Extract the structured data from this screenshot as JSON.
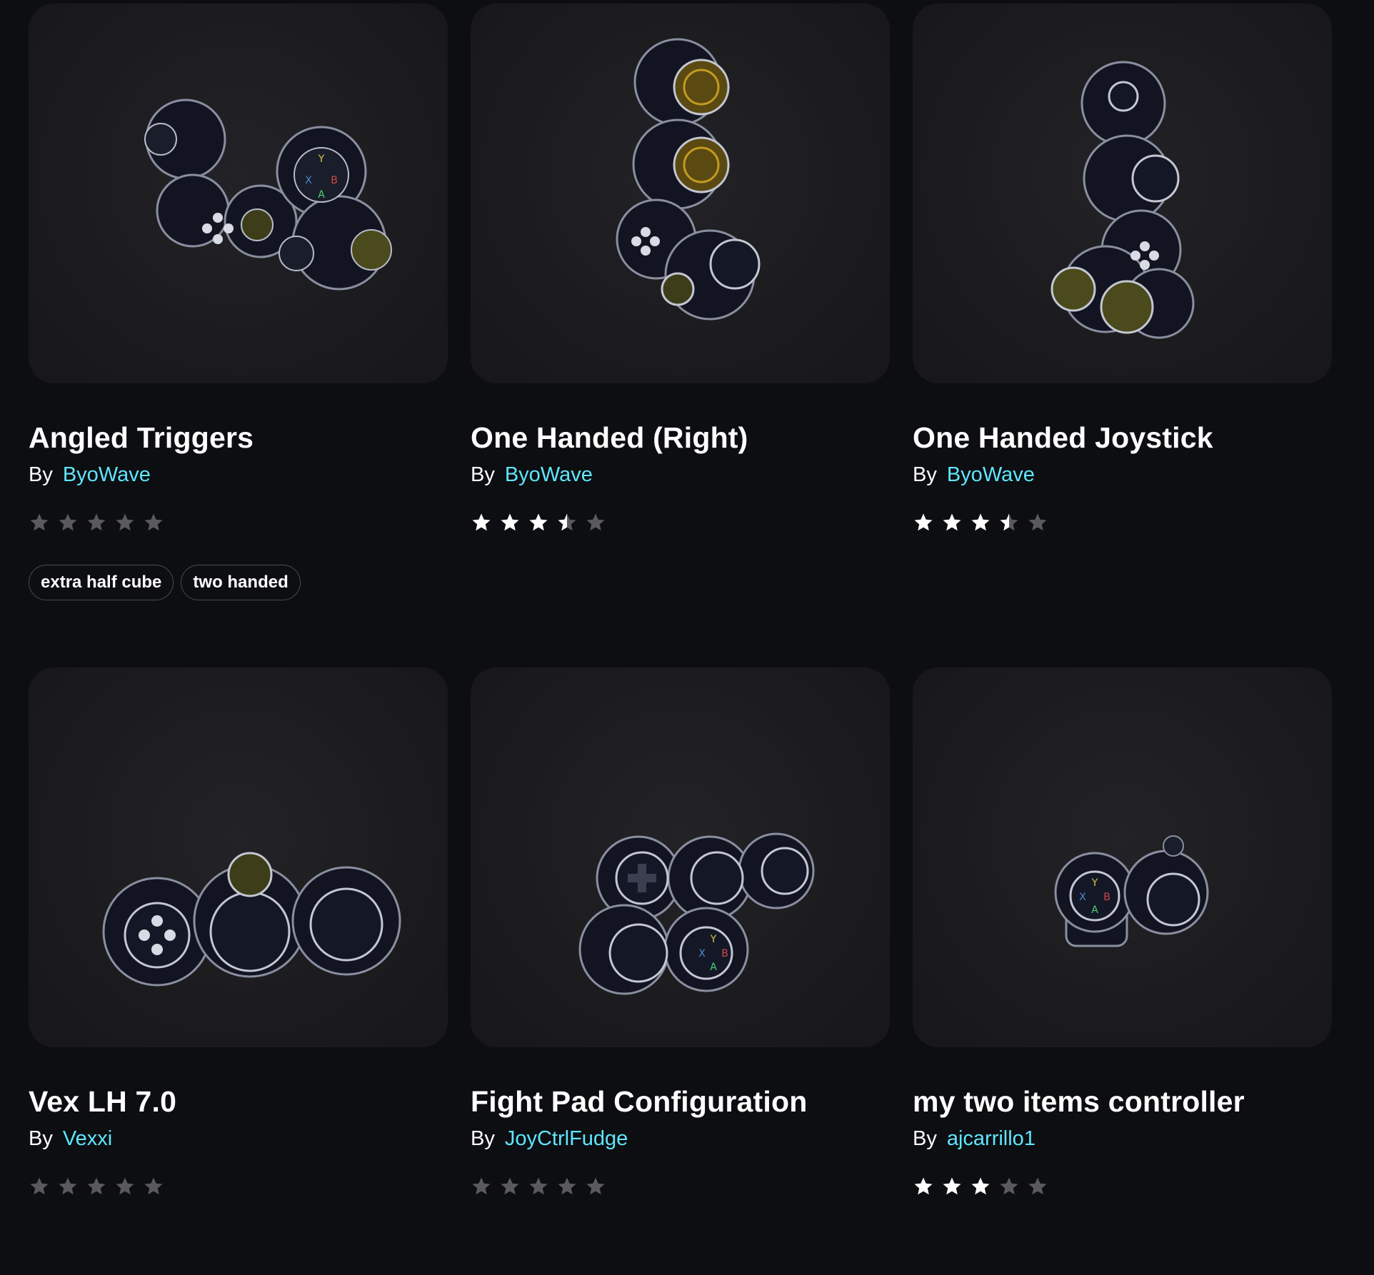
{
  "colors": {
    "background": "#0d0e11",
    "card": "#1c1c1f",
    "author_link": "#5fe6ff",
    "star_filled": "#ffffff",
    "star_empty": "#5a5a5e"
  },
  "by_label": "By",
  "cards": [
    {
      "title": "Angled Triggers",
      "author": "ByoWave",
      "rating": 0,
      "tags": [
        "extra half cube",
        "two handed"
      ],
      "image_icon": "controller-model-icon"
    },
    {
      "title": "One Handed (Right)",
      "author": "ByoWave",
      "rating": 3.5,
      "tags": [],
      "image_icon": "controller-model-icon"
    },
    {
      "title": "One Handed Joystick",
      "author": "ByoWave",
      "rating": 3.5,
      "tags": [],
      "image_icon": "controller-model-icon"
    },
    {
      "title": "Vex LH 7.0",
      "author": "Vexxi",
      "rating": 0,
      "tags": [],
      "image_icon": "controller-model-icon"
    },
    {
      "title": "Fight Pad Configuration",
      "author": "JoyCtrlFudge",
      "rating": 0,
      "tags": [],
      "image_icon": "controller-model-icon"
    },
    {
      "title": "my two items controller",
      "author": "ajcarrillo1",
      "rating": 3,
      "tags": [],
      "image_icon": "controller-model-icon"
    }
  ]
}
